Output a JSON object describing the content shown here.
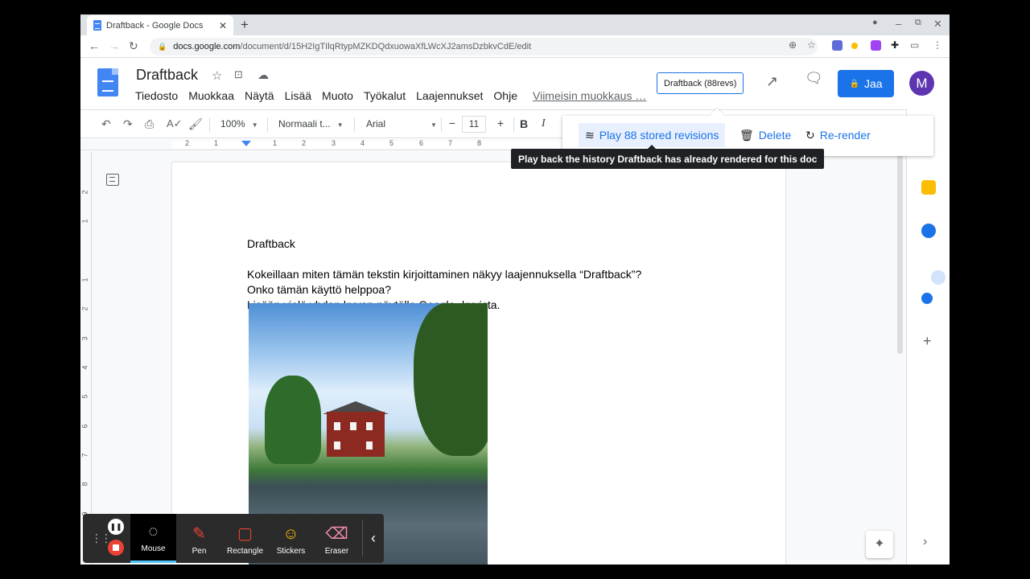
{
  "browser": {
    "tab_title": "Draftback - Google Docs",
    "tab_close": "✕",
    "new_tab": "+",
    "url_host": "docs.google.com",
    "url_path": "/document/d/15H2IgTIlqRtypMZKDQdxuowaXfLWcXJ2amsDzbkvCdE/edit"
  },
  "docs": {
    "title": "Draftback",
    "menu": [
      "Tiedosto",
      "Muokkaa",
      "Näytä",
      "Lisää",
      "Muoto",
      "Työkalut",
      "Laajennukset",
      "Ohje"
    ],
    "last_edit": "Viimeisin muokkaus …",
    "draftback_button": "Draftback (88revs)",
    "share_button": "Jaa",
    "avatar_letter": "M"
  },
  "toolbar": {
    "zoom": "100%",
    "style": "Normaali t...",
    "font": "Arial",
    "font_size": "11",
    "minus": "−",
    "plus": "+",
    "bold": "B",
    "italic": "I"
  },
  "ruler": {
    "numbers": [
      "2",
      "1",
      "1",
      "2",
      "3",
      "4",
      "5",
      "6",
      "7",
      "8"
    ]
  },
  "vruler": {
    "numbers": [
      "2",
      "1",
      "1",
      "2",
      "3",
      "4",
      "5",
      "6",
      "7",
      "8",
      "9"
    ]
  },
  "document": {
    "heading": "Draftback",
    "lines": [
      "Kokeillaan miten tämän tekstin kirjoittaminen näkyy laajennuksella “Draftback”?",
      "Onko tämän käyttö helppoa?",
      "Lisään vielä yhden kuvan näytölle Google -kuvista."
    ]
  },
  "draftback_popup": {
    "play_label": "Play 88 stored revisions",
    "delete_label": "Delete",
    "rerender_label": "Re-render",
    "tooltip": "Play back the history Draftback has already rendered for this doc"
  },
  "screencast": {
    "tools": [
      "Mouse",
      "Pen",
      "Rectangle",
      "Stickers",
      "Eraser"
    ]
  },
  "colors": {
    "accent": "#1a73e8",
    "avatar": "#5e35b1",
    "record": "#ea4335"
  }
}
